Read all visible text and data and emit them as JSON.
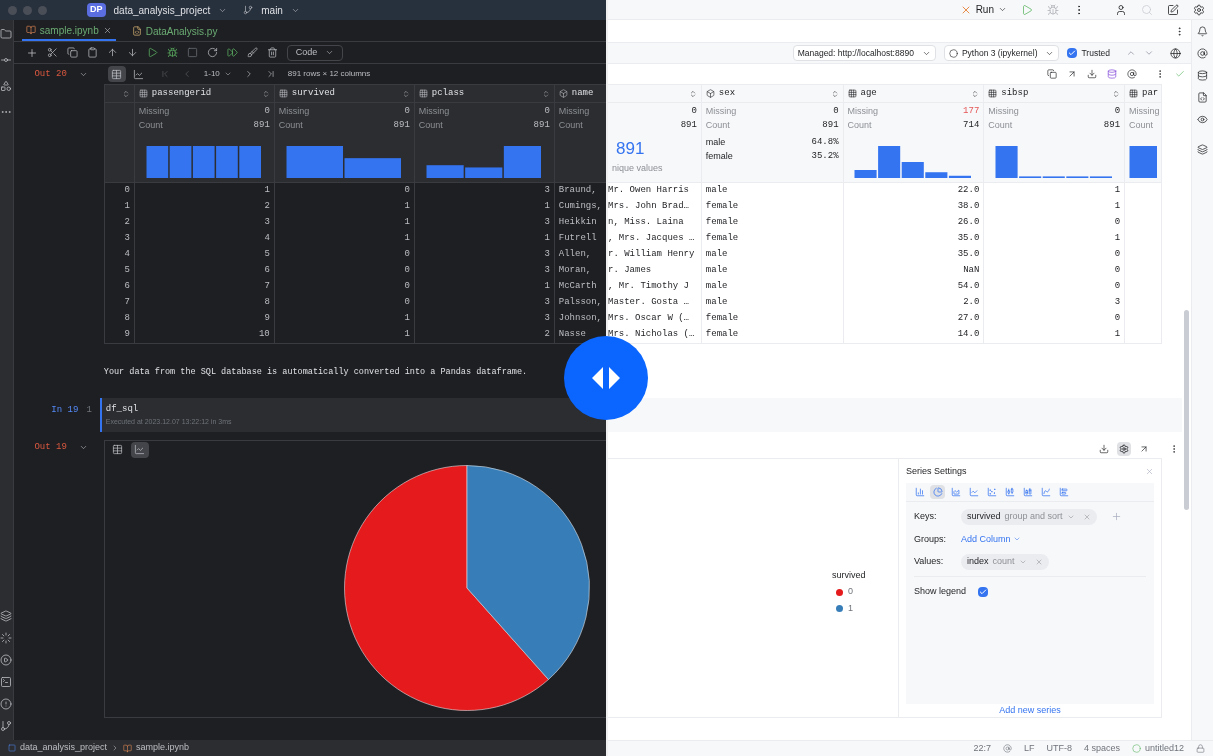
{
  "left": {
    "title_bar": {
      "badge": "DP",
      "project": "data_analysis_project",
      "branch": "main"
    },
    "tabs": [
      {
        "label": "sample.ipynb",
        "kind": "notebook",
        "selected": true
      },
      {
        "label": "DataAnalysis.py",
        "kind": "python",
        "selected": false
      }
    ],
    "cell_type": "Code",
    "out_20": {
      "label": "Out 20",
      "views": [
        {
          "kind": "table",
          "selected": true
        },
        {
          "kind": "chart",
          "selected": false
        }
      ],
      "pager": "1-10",
      "summary": "891 rows × 12 columns"
    },
    "table": {
      "columns": [
        {
          "name": "passengerid",
          "kind": "numeric",
          "missing_label": "Missing",
          "missing": "0",
          "count_label": "Count",
          "count": "891"
        },
        {
          "name": "survived",
          "kind": "numeric",
          "missing_label": "Missing",
          "missing": "0",
          "count_label": "Count",
          "count": "891"
        },
        {
          "name": "pclass",
          "kind": "numeric",
          "missing_label": "Missing",
          "missing": "0",
          "count_label": "Count",
          "count": "891"
        },
        {
          "name": "name",
          "kind": "text",
          "missing_label": "Missing",
          "count_label": "Count"
        }
      ],
      "rows": [
        {
          "index": "0",
          "cells": [
            "1",
            "0",
            "3",
            "Braund,"
          ]
        },
        {
          "index": "1",
          "cells": [
            "2",
            "1",
            "1",
            "Cumings,"
          ]
        },
        {
          "index": "2",
          "cells": [
            "3",
            "1",
            "3",
            "Heikkin"
          ]
        },
        {
          "index": "3",
          "cells": [
            "4",
            "1",
            "1",
            "Futrell"
          ]
        },
        {
          "index": "4",
          "cells": [
            "5",
            "0",
            "3",
            "Allen,"
          ]
        },
        {
          "index": "5",
          "cells": [
            "6",
            "0",
            "3",
            "Moran,"
          ]
        },
        {
          "index": "6",
          "cells": [
            "7",
            "0",
            "1",
            "McCarth"
          ]
        },
        {
          "index": "7",
          "cells": [
            "8",
            "0",
            "3",
            "Palsson,"
          ]
        },
        {
          "index": "8",
          "cells": [
            "9",
            "1",
            "3",
            "Johnson,"
          ]
        },
        {
          "index": "9",
          "cells": [
            "10",
            "1",
            "2",
            "Nasse"
          ]
        }
      ]
    },
    "markdown": "Your data from the SQL database is automatically converted into a Pandas dataframe.",
    "in_19": {
      "label": "In 19",
      "line": "1",
      "code": "df_sql",
      "executed": "Executed at 2023.12.07 13:22:12 in 3ms"
    },
    "out_19": {
      "label": "Out 19",
      "views": [
        {
          "kind": "table",
          "selected": false
        },
        {
          "kind": "chart",
          "selected": true
        }
      ]
    },
    "status_bar": {
      "project": "data_analysis_project",
      "file": "sample.ipynb"
    }
  },
  "right": {
    "run": "Run",
    "server": "Managed: http://localhost:8890",
    "kernel": "Python 3 (ipykernel)",
    "trusted": {
      "label": "Trusted",
      "checked": true
    },
    "table": {
      "name_rest": {
        "missing": "0",
        "count": "891",
        "unique": "891",
        "unique_label": "nique values"
      },
      "columns": [
        {
          "name": "sex",
          "kind": "text",
          "missing_label": "Missing",
          "missing": "0",
          "missing_highlighted": false,
          "count_label": "Count",
          "count": "891",
          "shares": [
            {
              "label": "male",
              "value": "64.8%"
            },
            {
              "label": "female",
              "value": "35.2%"
            }
          ]
        },
        {
          "name": "age",
          "kind": "numeric",
          "missing_label": "Missing",
          "missing": "177",
          "missing_highlighted": true,
          "count_label": "Count",
          "count": "714"
        },
        {
          "name": "sibsp",
          "kind": "numeric",
          "missing_label": "Missing",
          "missing": "0",
          "missing_highlighted": false,
          "count_label": "Count",
          "count": "891"
        },
        {
          "name": "par",
          "kind": "numeric",
          "missing_label": "Missing",
          "count_label": "Count"
        }
      ],
      "rows": [
        {
          "name_rest": "Mr. Owen Harris",
          "cells": [
            "male",
            "22.0",
            "1"
          ]
        },
        {
          "name_rest": "Mrs. John Brad…",
          "cells": [
            "female",
            "38.0",
            "1"
          ]
        },
        {
          "name_rest": "n, Miss. Laina",
          "cells": [
            "female",
            "26.0",
            "0"
          ]
        },
        {
          "name_rest": ", Mrs. Jacques …",
          "cells": [
            "female",
            "35.0",
            "1"
          ]
        },
        {
          "name_rest": "r. William Henry",
          "cells": [
            "male",
            "35.0",
            "0"
          ]
        },
        {
          "name_rest": "r. James",
          "cells": [
            "male",
            "NaN",
            "0"
          ]
        },
        {
          "name_rest": ", Mr. Timothy J",
          "cells": [
            "male",
            "54.0",
            "0"
          ]
        },
        {
          "name_rest": "Master. Gosta …",
          "cells": [
            "male",
            "2.0",
            "3"
          ]
        },
        {
          "name_rest": "Mrs. Oscar W (…",
          "cells": [
            "female",
            "27.0",
            "0"
          ]
        },
        {
          "name_rest": "Mrs. Nicholas (…",
          "cells": [
            "female",
            "14.0",
            "1"
          ]
        }
      ]
    },
    "legend": {
      "title": "survived",
      "items": [
        {
          "label": "0",
          "color": "#e41a1c"
        },
        {
          "label": "1",
          "color": "#377eb8"
        }
      ]
    },
    "series_settings": {
      "title": "Series Settings",
      "chart_types": [
        {
          "kind": "bar",
          "selected": false
        },
        {
          "kind": "pie",
          "selected": true
        },
        {
          "kind": "area",
          "selected": false
        },
        {
          "kind": "line",
          "selected": false
        },
        {
          "kind": "scatter",
          "selected": false
        },
        {
          "kind": "candlestick",
          "selected": false
        },
        {
          "kind": "stacked",
          "selected": false
        },
        {
          "kind": "spline",
          "selected": false
        },
        {
          "kind": "histogram",
          "selected": false
        }
      ],
      "keys_label": "Keys:",
      "key": {
        "column": "survived",
        "op": "group and sort"
      },
      "groups_label": "Groups:",
      "add_column": "Add Column",
      "values_label": "Values:",
      "value": {
        "column": "index",
        "op": "count"
      },
      "show_legend": {
        "label": "Show legend",
        "checked": true
      },
      "add_series": "Add new series"
    },
    "status_bar": [
      "22:7",
      "LF",
      "UTF-8",
      "4 spaces",
      "untitled12"
    ]
  }
}
